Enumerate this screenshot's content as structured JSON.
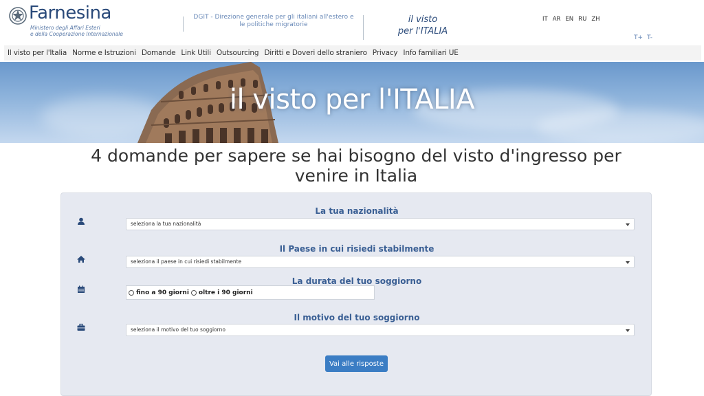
{
  "header": {
    "logo_title": "Farnesina",
    "logo_sub1": "Ministero degli Affari Esteri",
    "logo_sub2": "e della Cooperazione Internazionale",
    "dgit_text": "DGIT - Direzione generale per gli italiani all'estero e le politiche migratorie",
    "visto_line1": "il visto",
    "visto_line2": "per l'ITALIA",
    "languages": [
      "IT",
      "AR",
      "EN",
      "RU",
      "ZH"
    ],
    "font_increase": "T+",
    "font_decrease": "T-"
  },
  "nav": {
    "items": [
      "Il visto per l'Italia",
      "Norme e Istruzioni",
      "Domande",
      "Link Utili",
      "Outsourcing",
      "Diritti e Doveri dello straniero",
      "Privacy",
      "Info familiari UE"
    ]
  },
  "banner": {
    "title": "il visto per l'ITALIA"
  },
  "main": {
    "headline": "4 domande per sapere se hai bisogno del visto d'ingresso per venire in Italia"
  },
  "form": {
    "q1_label": "La tua nazionalità",
    "q1_select": "seleziona la tua nazionalità",
    "q2_label": "Il Paese in cui risiedi stabilmente",
    "q2_select": "seleziona il paese in cui risiedi stabilmente",
    "q3_label": "La durata del tuo soggiorno",
    "q3_option1": "fino a 90 giorni",
    "q3_option2": "oltre i 90 giorni",
    "q4_label": "Il motivo del tuo soggiorno",
    "q4_select": "seleziona il motivo del tuo soggiorno",
    "submit_label": "Vai alle risposte"
  },
  "icons": {
    "q1": "user-icon",
    "q2": "home-icon",
    "q3": "calendar-icon",
    "q4": "briefcase-icon"
  },
  "colors": {
    "brand": "#2a4a7a",
    "accent": "#3b7dc4",
    "label": "#3a5f94",
    "panel": "#e6e9f1"
  }
}
